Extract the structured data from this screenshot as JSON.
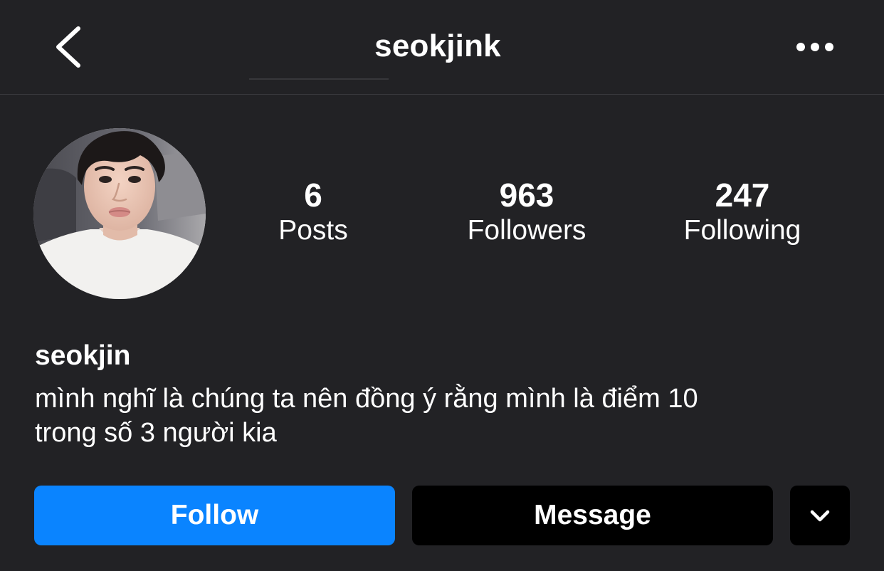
{
  "header": {
    "back_icon": "chevron-left-icon",
    "title": "seokjink",
    "more_icon": "ellipsis-horizontal-icon"
  },
  "profile": {
    "avatar": "profile-photo",
    "display_name": "seokjin",
    "bio_line1": "mình nghĩ là chúng ta nên đồng ý rằng mình là điểm 10",
    "bio_line2": "trong số 3 người kia"
  },
  "stats": {
    "posts": {
      "count": "6",
      "label": "Posts"
    },
    "followers": {
      "count": "963",
      "label": "Followers"
    },
    "following": {
      "count": "247",
      "label": "Following"
    }
  },
  "actions": {
    "follow_label": "Follow",
    "message_label": "Message",
    "dropdown_icon": "chevron-down-icon"
  },
  "colors": {
    "background": "#222225",
    "accent": "#0a84ff",
    "button_dark": "#000000",
    "text": "#ffffff"
  }
}
